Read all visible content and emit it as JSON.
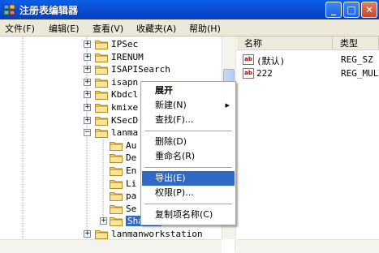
{
  "window": {
    "title": "注册表编辑器"
  },
  "menubar": [
    "文件(F)",
    "编辑(E)",
    "查看(V)",
    "收藏夹(A)",
    "帮助(H)"
  ],
  "tree": [
    {
      "label": "IPSec",
      "expander": "+"
    },
    {
      "label": "IRENUM",
      "expander": "+"
    },
    {
      "label": "ISAPISearch",
      "expander": "+"
    },
    {
      "label": "isapn",
      "expander": "+"
    },
    {
      "label": "Kbdcl",
      "expander": "+"
    },
    {
      "label": "kmixe",
      "expander": "+"
    },
    {
      "label": "KSecD",
      "expander": "+"
    },
    {
      "label": "lanma",
      "expander": "-"
    },
    {
      "label": "Au",
      "expander": ""
    },
    {
      "label": "De",
      "expander": ""
    },
    {
      "label": "En",
      "expander": ""
    },
    {
      "label": "Li",
      "expander": ""
    },
    {
      "label": "pa",
      "expander": ""
    },
    {
      "label": "Se",
      "expander": ""
    },
    {
      "label": "Shares",
      "expander": "+"
    },
    {
      "label": "lanmanworkstation",
      "expander": "+"
    }
  ],
  "columns": {
    "name": "名称",
    "type": "类型"
  },
  "values": [
    {
      "name": "(默认)",
      "type": "REG_SZ"
    },
    {
      "name": "222",
      "type": "REG_MULT"
    }
  ],
  "context_menu": {
    "expand": "展开",
    "new": "新建(N)",
    "find": "查找(F)...",
    "delete": "删除(D)",
    "rename": "重命名(R)",
    "export": "导出(E)",
    "permissions": "权限(P)...",
    "copy_key_name": "复制项名称(C)"
  },
  "colors": {
    "titlebar": "#0a4fd6",
    "selection": "#316ac5",
    "chrome": "#ece9d8"
  }
}
